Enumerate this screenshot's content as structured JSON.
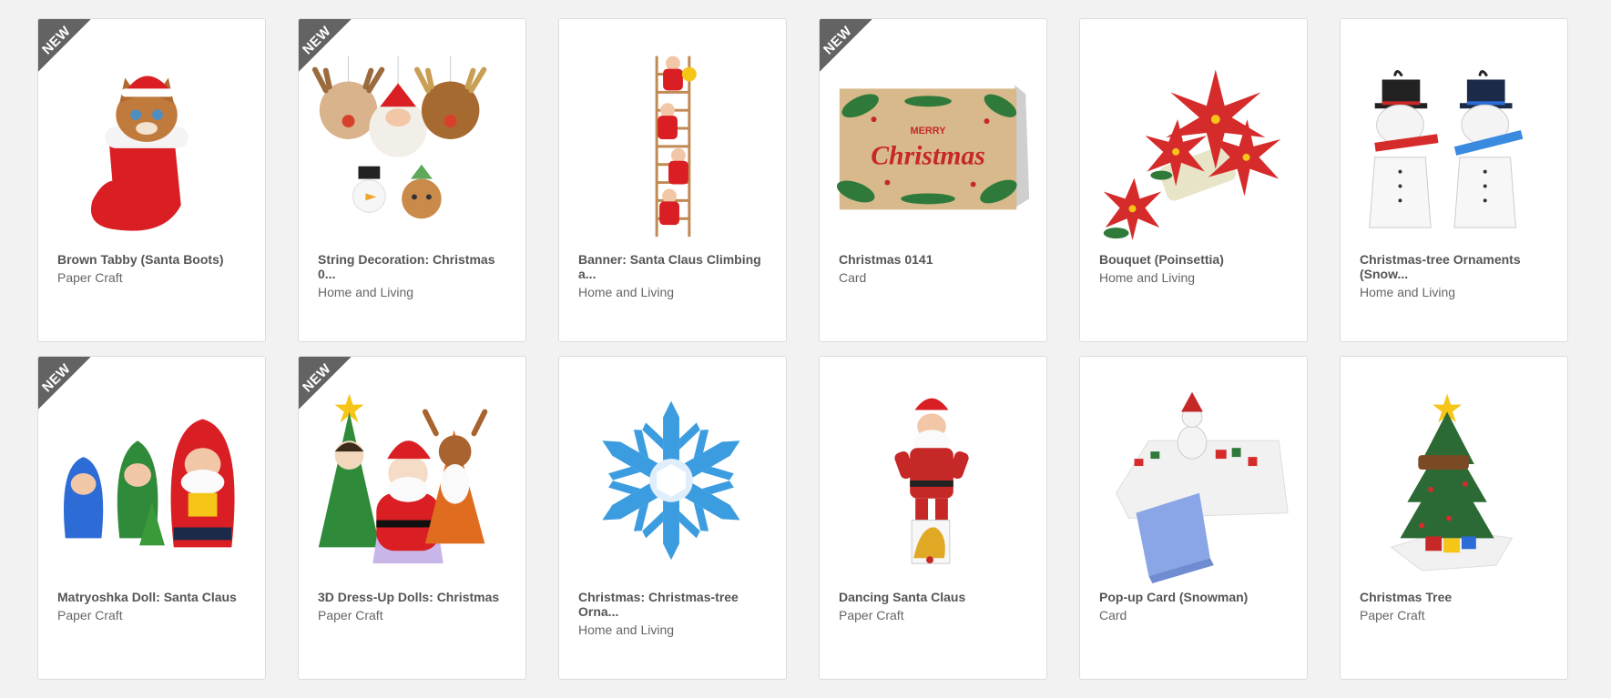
{
  "products": [
    {
      "title": "Brown Tabby (Santa Boots)",
      "category": "Paper Craft",
      "is_new": true,
      "badge": "NEW",
      "icon": "cat-in-santa-boot"
    },
    {
      "title": "String Decoration: Christmas 0...",
      "category": "Home and Living",
      "is_new": true,
      "badge": "NEW",
      "icon": "reindeer-santa-string-decoration"
    },
    {
      "title": "Banner: Santa Claus Climbing a...",
      "category": "Home and Living",
      "is_new": false,
      "badge": "",
      "icon": "santa-ladder-banner"
    },
    {
      "title": "Christmas 0141",
      "category": "Card",
      "is_new": true,
      "badge": "NEW",
      "icon": "merry-christmas-card"
    },
    {
      "title": "Bouquet (Poinsettia)",
      "category": "Home and Living",
      "is_new": false,
      "badge": "",
      "icon": "poinsettia-bouquet"
    },
    {
      "title": "Christmas-tree Ornaments (Snow...",
      "category": "Home and Living",
      "is_new": false,
      "badge": "",
      "icon": "snowman-ornaments"
    },
    {
      "title": "Matryoshka Doll: Santa Claus",
      "category": "Paper Craft",
      "is_new": true,
      "badge": "NEW",
      "icon": "matryoshka-santa-dolls"
    },
    {
      "title": "3D Dress-Up Dolls: Christmas",
      "category": "Paper Craft",
      "is_new": true,
      "badge": "NEW",
      "icon": "dress-up-dolls"
    },
    {
      "title": "Christmas: Christmas-tree Orna...",
      "category": "Home and Living",
      "is_new": false,
      "badge": "",
      "icon": "snowflake-ornament"
    },
    {
      "title": "Dancing Santa Claus",
      "category": "Paper Craft",
      "is_new": false,
      "badge": "",
      "icon": "dancing-santa"
    },
    {
      "title": "Pop-up Card (Snowman)",
      "category": "Card",
      "is_new": false,
      "badge": "",
      "icon": "snowman-popup-card"
    },
    {
      "title": "Christmas Tree",
      "category": "Paper Craft",
      "is_new": false,
      "badge": "",
      "icon": "christmas-tree"
    }
  ],
  "card_text": {
    "merry": "MERRY",
    "christmas": "Christmas"
  },
  "colors": {
    "background": "#f2f2f2",
    "ribbon": "#636363",
    "title": "#555555",
    "category": "#666666"
  }
}
